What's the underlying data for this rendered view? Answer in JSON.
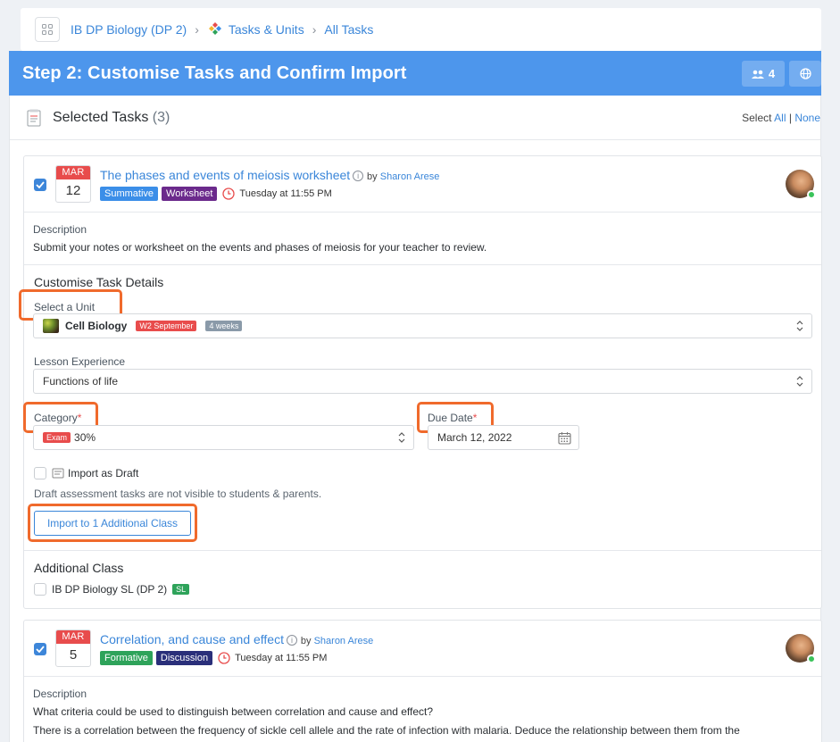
{
  "breadcrumb": {
    "course": "IB DP Biology (DP 2)",
    "section": "Tasks & Units",
    "page": "All Tasks"
  },
  "header": {
    "title": "Step 2: Customise Tasks and Confirm Import",
    "people_count": "4"
  },
  "selected": {
    "title": "Selected Tasks",
    "count": "(3)",
    "select_label": "Select",
    "all": "All",
    "sep": "|",
    "none": "None"
  },
  "tasks": [
    {
      "month": "MAR",
      "day": "12",
      "title": "The phases and events of meiosis worksheet",
      "by_prefix": "by",
      "author": "Sharon Arese",
      "type": "Summative",
      "type_color": "#3b8ee8",
      "kind": "Worksheet",
      "kind_color": "#6b2a8c",
      "due": "Tuesday at 11:55 PM",
      "description_label": "Description",
      "description": "Submit your notes or worksheet on the events and phases of meiosis for your teacher to review."
    },
    {
      "month": "MAR",
      "day": "5",
      "title": "Correlation, and cause and effect",
      "by_prefix": "by",
      "author": "Sharon Arese",
      "type": "Formative",
      "type_color": "#2ea35a",
      "kind": "Discussion",
      "kind_color": "#2a2f7a",
      "due": "Tuesday at 11:55 PM",
      "description_label": "Description",
      "description": "What criteria could be used to distinguish between correlation and cause and effect?",
      "description_2": "There is a correlation between the frequency of sickle cell allele and the rate of infection with malaria. Deduce the relationship between them from the"
    }
  ],
  "customise": {
    "title": "Customise Task Details",
    "unit_label": "Select a Unit",
    "unit_value": "Cell Biology",
    "unit_tag_1": "W2 September",
    "unit_tag_2": "4 weeks",
    "lesson_label": "Lesson Experience",
    "lesson_value": "Functions of life",
    "category_label": "Category",
    "category_tag": "Exam",
    "category_value": "30%",
    "due_label": "Due Date",
    "due_value": "March 12, 2022",
    "required_mark": "*",
    "draft_label": "Import as Draft",
    "draft_note": "Draft assessment tasks are not visible to students & parents.",
    "import_button": "Import to 1 Additional Class",
    "additional_title": "Additional Class",
    "additional_class": "IB DP Biology SL (DP 2)",
    "additional_badge": "SL"
  },
  "colors": {
    "accent": "#4d96ec",
    "link": "#3a86d9",
    "highlight": "#f06a2c",
    "danger": "#e84c4c",
    "success": "#2ea35a"
  }
}
